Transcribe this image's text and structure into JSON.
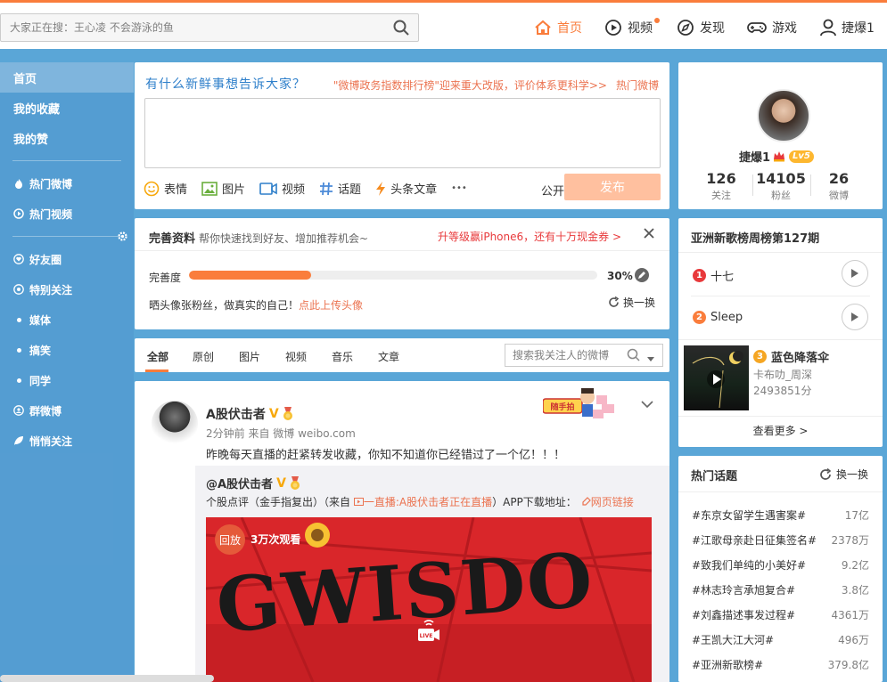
{
  "search": {
    "placeholder": "大家正在搜：王心凌 不会游泳的鱼"
  },
  "nav": [
    {
      "label": "首页",
      "icon": "home-icon"
    },
    {
      "label": "视频",
      "icon": "video-icon"
    },
    {
      "label": "发现",
      "icon": "compass-icon"
    },
    {
      "label": "游戏",
      "icon": "gamepad-icon"
    },
    {
      "label": "捷爆1",
      "icon": "user-icon"
    }
  ],
  "sidebar": {
    "top": [
      "首页",
      "我的收藏",
      "我的赞"
    ],
    "mid": [
      "热门微博",
      "热门视频"
    ],
    "groups": [
      "好友圈",
      "特别关注",
      "媒体",
      "搞笑",
      "同学",
      "群微博",
      "悄悄关注"
    ]
  },
  "publisher": {
    "prompt": "有什么新鲜事想告诉大家？",
    "link1": "\"微博政务指数排行榜\"迎来重大改版，评价体系更科学>>",
    "link2": "热门微博",
    "tools": [
      "表情",
      "图片",
      "视频",
      "话题",
      "头条文章"
    ],
    "more": "•••",
    "visibility": "公开",
    "submit": "发布"
  },
  "profile_progress": {
    "title": "完善资料",
    "subtitle": "帮你快速找到好友、增加推荐机会~",
    "promo": "升等级赢iPhone6，还有十万现金券 >",
    "label": "完善度",
    "percent_text": "30%",
    "percent_value": 0.3,
    "tip": "晒头像张粉丝，做真实的自己！",
    "tip_link": "点此上传头像",
    "refresh": "换一换"
  },
  "filter": {
    "tabs": [
      "全部",
      "原创",
      "图片",
      "视频",
      "音乐",
      "文章"
    ],
    "search_placeholder": "搜索我关注人的微博"
  },
  "post": {
    "author": "A股伏击者",
    "verified": "V",
    "meta": "2分钟前 来自 微博 weibo.com",
    "text": "昨晚每天直播的赶紧转发收藏，你知不知道你已经错过了一个亿！！！",
    "deco": "随手拍",
    "repost": {
      "author": "@A股伏击者",
      "verified": "V",
      "line_prefix": "个股点评（金手指复出）（来自",
      "live_label": "一直播:A股伏击者正在直播",
      "line_suffix": "）APP下载地址：",
      "link": "网页链接",
      "video": {
        "replay": "回放",
        "views": "3万次观看",
        "art_text": "GWISDO",
        "live_badge": "LIVE"
      }
    }
  },
  "right_profile": {
    "name": "捷爆1",
    "level": "Lv5",
    "stats": [
      {
        "n": "126",
        "l": "关注"
      },
      {
        "n": "14105",
        "l": "粉丝"
      },
      {
        "n": "26",
        "l": "微博"
      }
    ]
  },
  "songs": {
    "title": "亚洲新歌榜周榜第127期",
    "items": [
      {
        "rank": "1",
        "name": "十七"
      },
      {
        "rank": "2",
        "name": "Sleep"
      }
    ],
    "featured": {
      "rank": "3",
      "name": "蓝色降落伞",
      "artist": "卡布叻_周深",
      "score": "2493851分"
    },
    "more": "查看更多 >"
  },
  "topics": {
    "title": "热门话题",
    "refresh": "换一换",
    "items": [
      {
        "name": "#东京女留学生遇害案#",
        "count": "17亿"
      },
      {
        "name": "#江歌母亲赴日征集签名#",
        "count": "2378万"
      },
      {
        "name": "#致我们单纯的小美好#",
        "count": "9.2亿"
      },
      {
        "name": "#林志玲言承旭复合#",
        "count": "3.8亿"
      },
      {
        "name": "#刘鑫描述事发过程#",
        "count": "4361万"
      },
      {
        "name": "#王凯大江大河#",
        "count": "496万"
      },
      {
        "name": "#亚洲新歌榜#",
        "count": "379.8亿"
      }
    ]
  },
  "colors": {
    "accent": "#fa7d3c",
    "link": "#eb7350",
    "bg": "#5aa6d7",
    "blue": "#2e7fca"
  }
}
